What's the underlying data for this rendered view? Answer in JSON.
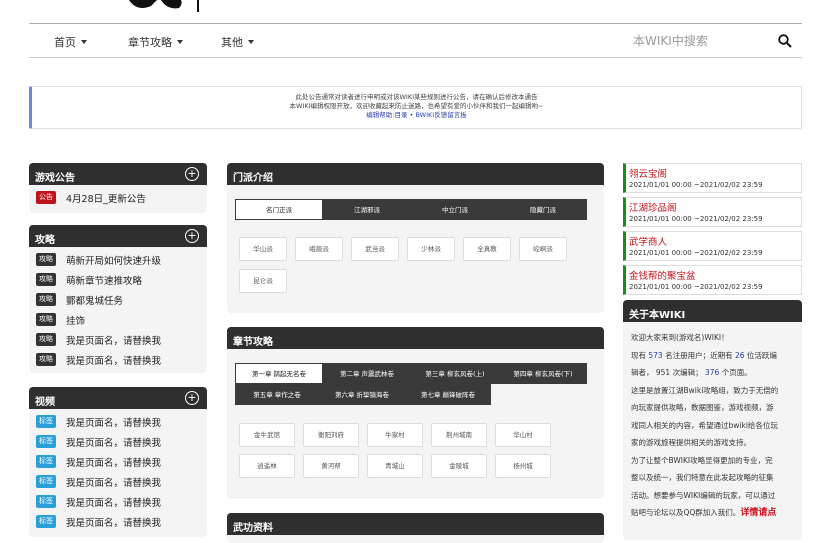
{
  "nav": {
    "items": [
      "首页",
      "章节攻略",
      "其他"
    ],
    "search_placeholder": "本WIKI中搜索"
  },
  "notice": {
    "line1": "此处公告通常对读者进行申明或对该WIKI某些规则进行公告，请在确认后修改本通告",
    "line2": "本WIKI编辑权限开放，欢迎收藏起来防止迷路，也希望有爱的小伙伴和我们一起编辑哟~",
    "help_link": "编辑帮助:目录",
    "sep": " • ",
    "feedback_link": "BWIKI反馈留言板"
  },
  "left": {
    "announce": {
      "title": "游戏公告",
      "items": [
        {
          "tag": "公告",
          "text": "4月28日_更新公告"
        }
      ]
    },
    "guides": {
      "title": "攻略",
      "items": [
        {
          "tag": "攻略",
          "text": "萌新开局如何快速升级"
        },
        {
          "tag": "攻略",
          "text": "萌新章节速推攻略"
        },
        {
          "tag": "攻略",
          "text": "酆都鬼城任务"
        },
        {
          "tag": "攻略",
          "text": "挂饰"
        },
        {
          "tag": "攻略",
          "text": "我是页面名，请替换我"
        },
        {
          "tag": "攻略",
          "text": "我是页面名，请替换我"
        }
      ]
    },
    "videos": {
      "title": "视频",
      "items": [
        {
          "tag": "标签",
          "text": "我是页面名，请替换我"
        },
        {
          "tag": "标签",
          "text": "我是页面名，请替换我"
        },
        {
          "tag": "标签",
          "text": "我是页面名，请替换我"
        },
        {
          "tag": "标签",
          "text": "我是页面名，请替换我"
        },
        {
          "tag": "标签",
          "text": "我是页面名，请替换我"
        },
        {
          "tag": "标签",
          "text": "我是页面名，请替换我"
        }
      ]
    },
    "plus": "+"
  },
  "center": {
    "sects": {
      "title": "门派介绍",
      "tabs": [
        "名门正派",
        "江湖邪派",
        "中立门派",
        "隐藏门派"
      ],
      "chips": [
        "华山派",
        "峨眉派",
        "武当派",
        "少林派",
        "全真教",
        "崆峒派",
        "昆仑派"
      ]
    },
    "chapters": {
      "title": "章节攻略",
      "tabs_row1": [
        "第一章 鹊起无名卷",
        "第二章 声震武林卷",
        "第三章 柳玄风卷(上)",
        "第四章 柳玄风卷(下)"
      ],
      "tabs_row2": [
        "第五章 章作之卷",
        "第六章 折挚镇海卷",
        "第七章 巅锋破阵卷"
      ],
      "chips": [
        "金牛武馆",
        "衡阳刘府",
        "牛家村",
        "荆州城南",
        "华山村",
        "逍遥林",
        "黄河帮",
        "青城山",
        "金陵城",
        "扬州城"
      ]
    },
    "next_title": "武功资料"
  },
  "right": {
    "events": [
      {
        "title": "翎云宝阁",
        "date": "2021/01/01 00:00 ~2021/02/02 23:59"
      },
      {
        "title": "江湖珍品阁",
        "date": "2021/01/01 00:00 ~2021/02/02 23:59"
      },
      {
        "title": "武学商人",
        "date": "2021/01/01 00:00 ~2021/02/02 23:59"
      },
      {
        "title": "金钱帮的聚宝盆",
        "date": "2021/01/01 00:00 ~2021/02/02 23:59"
      }
    ],
    "about": {
      "title": "关于本WIKI",
      "l1": "欢迎大家来到(游戏名)WIKI！",
      "l2a": "现有 ",
      "users": "573",
      "l2b": " 名注册用户；近期有 ",
      "active": "26",
      "l2c": " 位活跃编",
      "l3a": "辑者， ",
      "edits": "951",
      "l3b": " 次编辑； ",
      "pages": "376",
      "l3c": " 个页面。",
      "l4": "这里是放置江湖Bwiki攻略组，致力于无偿的",
      "l5": "向玩家提供攻略，数据图鉴，游戏视频，游",
      "l6": "戏同人相关的内容，希望通过bwiki给各位玩",
      "l7": "家的游戏旅程提供相关的游戏支持。",
      "l8": "为了让整个BWIKI攻略显得更加的专业，完",
      "l9": "整以及统一，我们特意在此发起攻略的征集",
      "l10": "活动。想要参与WIKI编辑的玩家，可以通过",
      "l11": "贴吧与论坛以及QQ群加入我们。",
      "more": "详情请点"
    }
  },
  "colors": {
    "announce_tag": "#c0121b",
    "guide_tag": "#333333",
    "video_tag": "#2aa0d8",
    "event_border": "#1b8c1b",
    "event_title": "#c0121b",
    "link_blue": "#2a3fa8"
  }
}
